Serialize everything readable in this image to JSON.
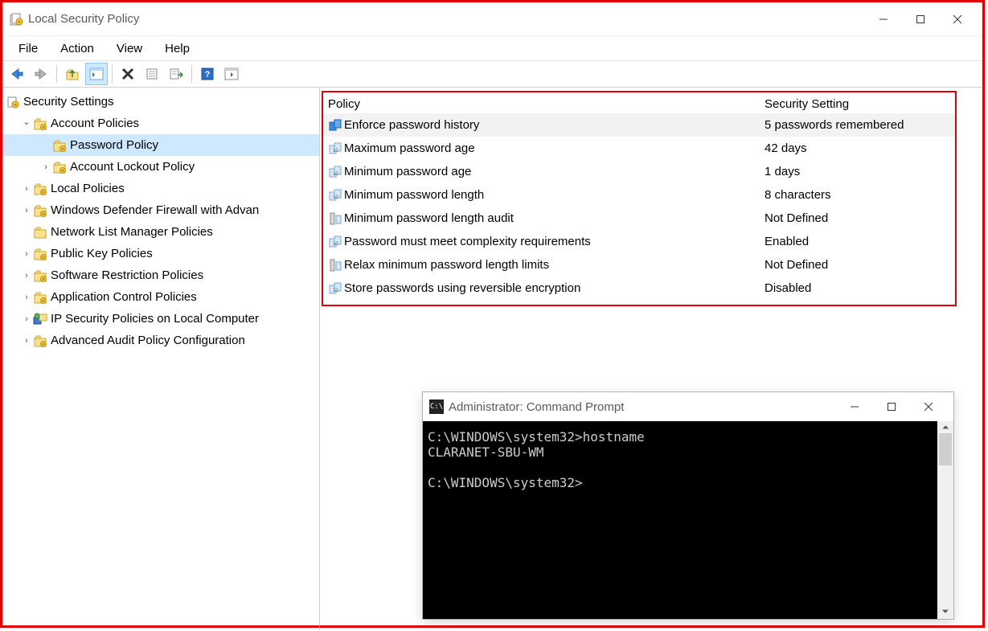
{
  "window": {
    "title": "Local Security Policy"
  },
  "menu": [
    "File",
    "Action",
    "View",
    "Help"
  ],
  "tree": {
    "root": "Security Settings",
    "items": [
      {
        "label": "Account Policies",
        "state": "expanded",
        "indent": 1,
        "expander": "v"
      },
      {
        "label": "Password Policy",
        "state": "selected",
        "indent": 2,
        "expander": ""
      },
      {
        "label": "Account Lockout Policy",
        "state": "collapsed",
        "indent": 2,
        "expander": ">"
      },
      {
        "label": "Local Policies",
        "state": "collapsed",
        "indent": 1,
        "expander": ">"
      },
      {
        "label": "Windows Defender Firewall with Advan",
        "state": "collapsed",
        "indent": 1,
        "expander": ">"
      },
      {
        "label": "Network List Manager Policies",
        "state": "leaf",
        "indent": 1,
        "expander": ""
      },
      {
        "label": "Public Key Policies",
        "state": "collapsed",
        "indent": 1,
        "expander": ">"
      },
      {
        "label": "Software Restriction Policies",
        "state": "collapsed",
        "indent": 1,
        "expander": ">"
      },
      {
        "label": "Application Control Policies",
        "state": "collapsed",
        "indent": 1,
        "expander": ">"
      },
      {
        "label": "IP Security Policies on Local Computer",
        "state": "collapsed",
        "indent": 1,
        "expander": ">",
        "icon": "ipsec"
      },
      {
        "label": "Advanced Audit Policy Configuration",
        "state": "collapsed",
        "indent": 1,
        "expander": ">"
      }
    ]
  },
  "list": {
    "headers": {
      "policy": "Policy",
      "setting": "Security Setting"
    },
    "rows": [
      {
        "policy": "Enforce password history",
        "setting": "5 passwords remembered",
        "selected": true
      },
      {
        "policy": "Maximum password age",
        "setting": "42 days"
      },
      {
        "policy": "Minimum password age",
        "setting": "1 days"
      },
      {
        "policy": "Minimum password length",
        "setting": "8 characters"
      },
      {
        "policy": "Minimum password length audit",
        "setting": "Not Defined"
      },
      {
        "policy": "Password must meet complexity requirements",
        "setting": "Enabled"
      },
      {
        "policy": "Relax minimum password length limits",
        "setting": "Not Defined"
      },
      {
        "policy": "Store passwords using reversible encryption",
        "setting": "Disabled"
      }
    ]
  },
  "cmd": {
    "title": "Administrator: Command Prompt",
    "lines": "C:\\WINDOWS\\system32>hostname\nCLARANET-SBU-WM\n\nC:\\WINDOWS\\system32>"
  }
}
